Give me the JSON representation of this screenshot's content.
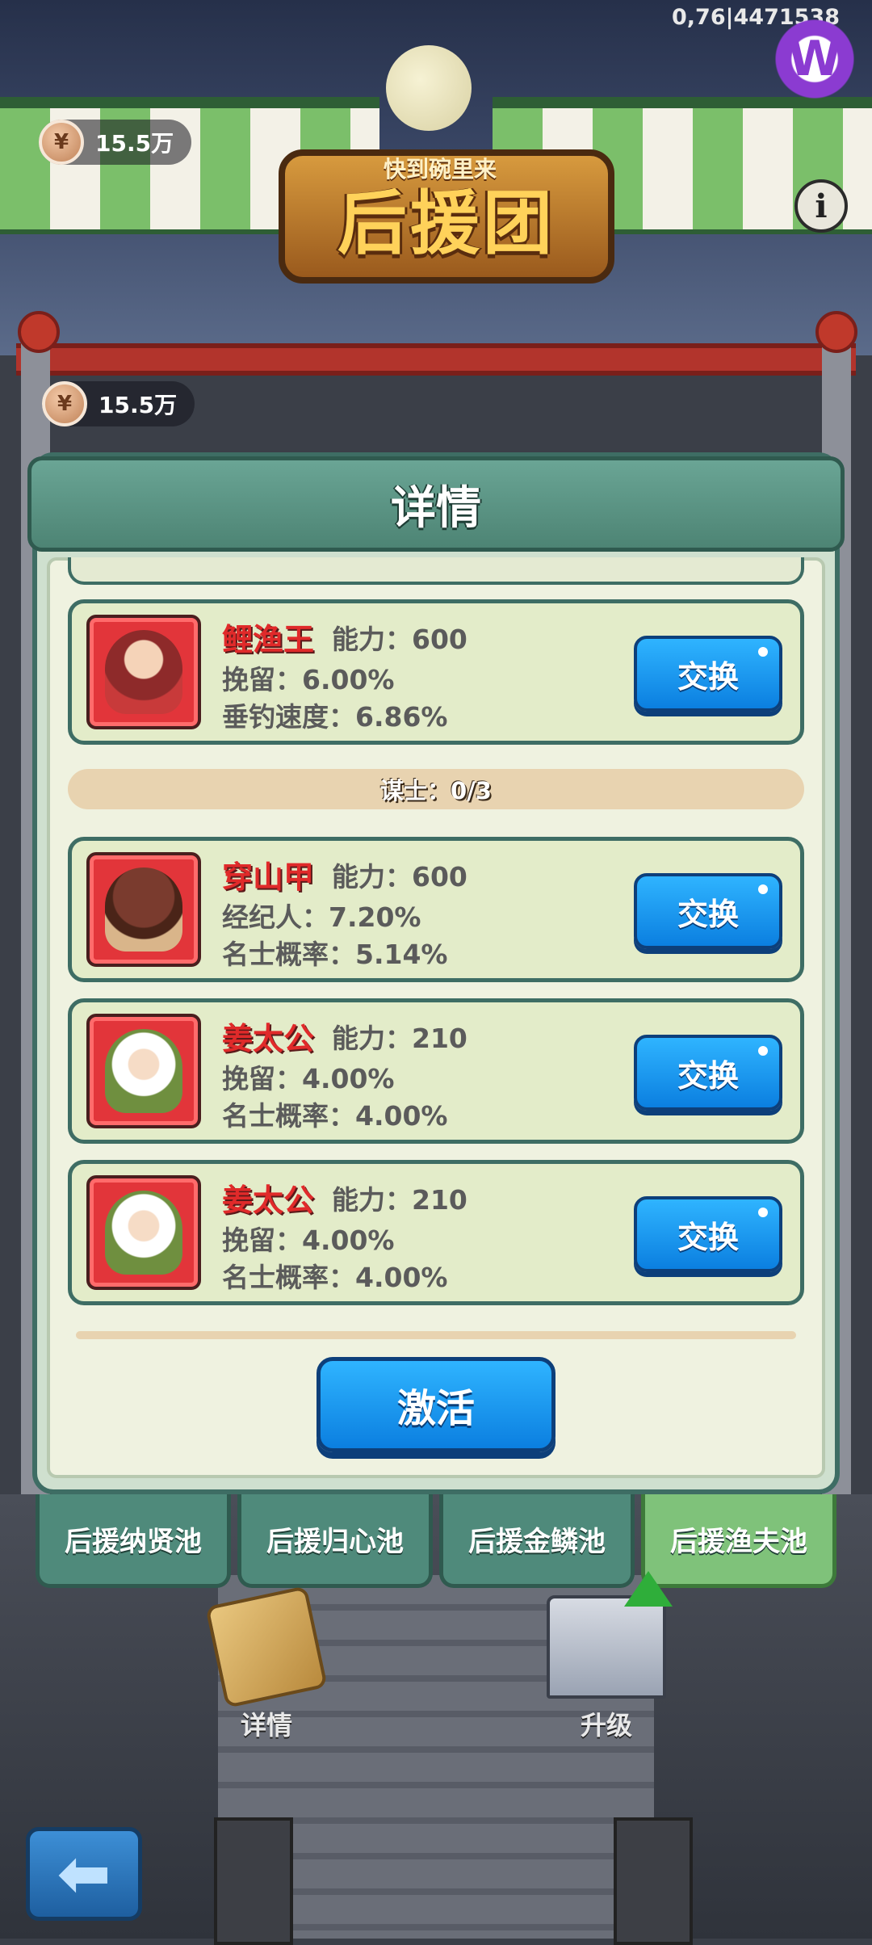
{
  "status": {
    "debug_text": "0,76|4471538"
  },
  "header": {
    "sign_subtitle": "快到碗里来",
    "sign_title": "后援团",
    "currency_top": "15.5万",
    "currency_second": "15.5万"
  },
  "dialog": {
    "title": "详情",
    "section_label": "谋士：0/3",
    "swap_label": "交换",
    "activate_label": "激活",
    "cards": [
      {
        "name": "鲤渔王",
        "ability": "能力：600",
        "stat1": "挽留：6.00%",
        "stat2": "垂钓速度：6.86%"
      },
      {
        "name": "穿山甲",
        "ability": "能力：600",
        "stat1": "经纪人：7.20%",
        "stat2": "名士概率：5.14%"
      },
      {
        "name": "姜太公",
        "ability": "能力：210",
        "stat1": "挽留：4.00%",
        "stat2": "名士概率：4.00%"
      },
      {
        "name": "姜太公",
        "ability": "能力：210",
        "stat1": "挽留：4.00%",
        "stat2": "名士概率：4.00%"
      }
    ]
  },
  "tabs": [
    {
      "label": "后援纳贤池",
      "active": false
    },
    {
      "label": "后援归心池",
      "active": false
    },
    {
      "label": "后援金鳞池",
      "active": false
    },
    {
      "label": "后援渔夫池",
      "active": true
    }
  ],
  "bottom": {
    "details_label": "详情",
    "upgrade_label": "升级"
  },
  "icons": {
    "info": "info-icon",
    "back": "back-arrow-icon",
    "coin": "coin-icon",
    "logo": "w-logo-icon"
  },
  "colors": {
    "accent_teal": "#4f8a7b",
    "active_tab": "#7fc27a",
    "button_blue": "#0b7fe0",
    "name_red": "#e02a2a"
  }
}
